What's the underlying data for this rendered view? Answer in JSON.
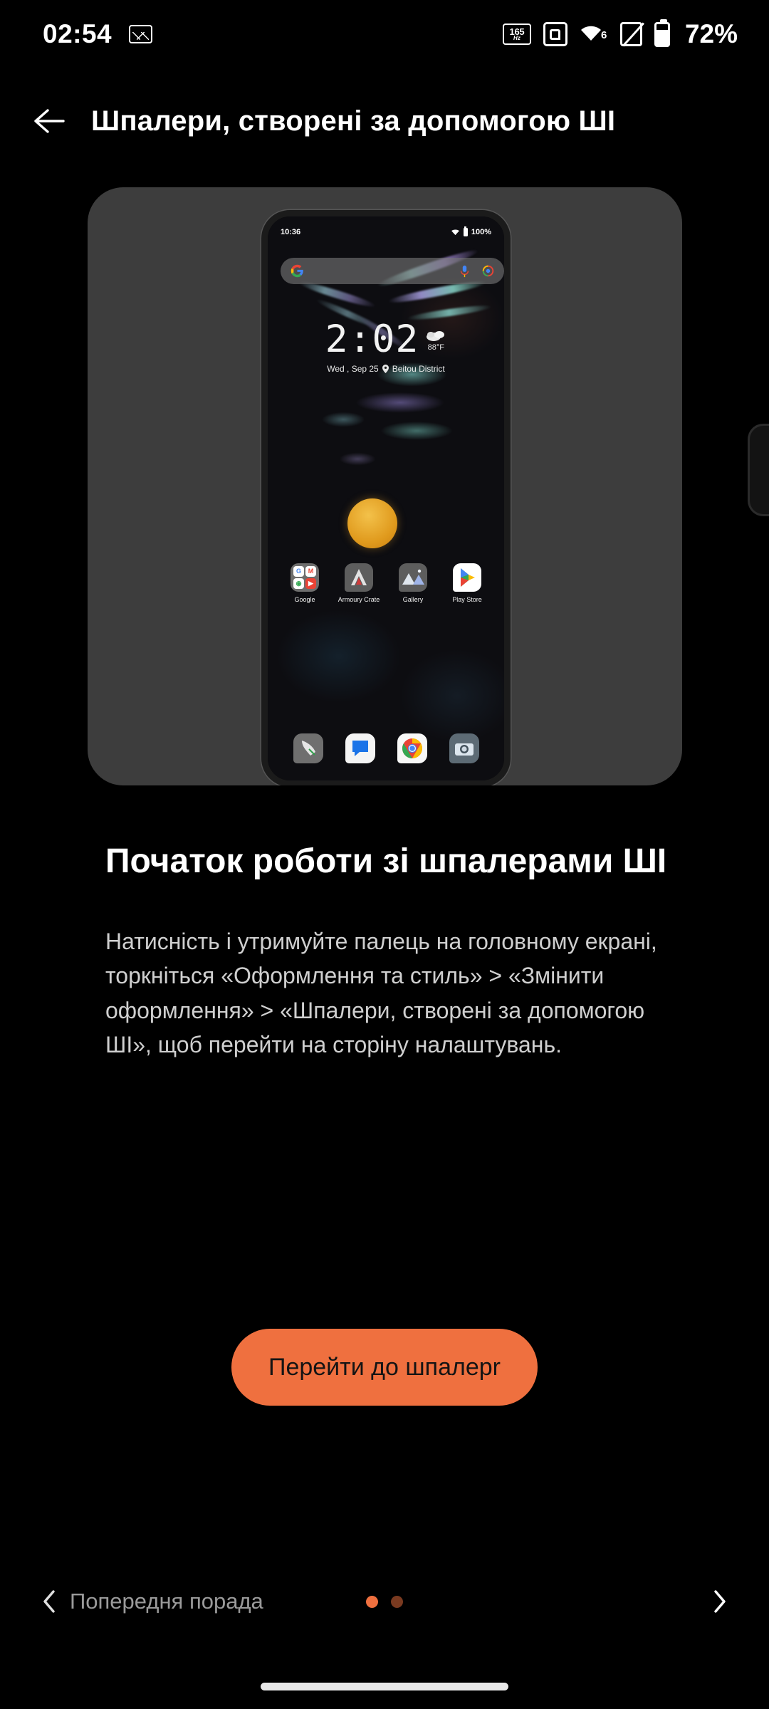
{
  "status_bar": {
    "time": "02:54",
    "battery_percent": "72%",
    "icons": [
      {
        "name": "screenshot-icon",
        "label": ""
      },
      {
        "name": "refresh-rate-icon",
        "label": "165",
        "unit": "Hz"
      },
      {
        "name": "screen-recorder-icon",
        "label": ""
      },
      {
        "name": "wifi-6-icon",
        "label": "6"
      },
      {
        "name": "no-sim-icon",
        "label": ""
      },
      {
        "name": "battery-icon",
        "label": ""
      }
    ]
  },
  "app_bar": {
    "back_icon": "arrow-left-icon",
    "title": "Шпалери, створені за допомогою ШІ"
  },
  "hero": {
    "phone_preview": {
      "status_time": "10:36",
      "status_battery": "100%",
      "search_placeholder": "",
      "search_logo": "google-g-icon",
      "mic_icon": "microphone-icon",
      "lens_icon": "google-lens-icon",
      "clock": "2:02",
      "temperature": "88°F",
      "weather_icon": "cloudy-icon",
      "date": "Wed , Sep 25",
      "location": "Beitou District",
      "location_icon": "location-pin-icon",
      "apps": [
        {
          "label": "Google",
          "icon": "google-folder-icon"
        },
        {
          "label": "Armoury Crate",
          "icon": "armoury-crate-icon"
        },
        {
          "label": "Gallery",
          "icon": "gallery-icon"
        },
        {
          "label": "Play Store",
          "icon": "play-store-icon"
        }
      ],
      "dock": [
        {
          "icon": "phone-dialer-icon"
        },
        {
          "icon": "messages-icon"
        },
        {
          "icon": "chrome-icon"
        },
        {
          "icon": "camera-icon"
        }
      ]
    }
  },
  "content": {
    "heading": "Початок роботи зі шпалерами ШІ",
    "paragraph": "Натисність і утримуйте палець на головному екрані, торкніться «Оформлення та стиль» > «Змінити оформлення» > «Шпалери, створені за допомогою ШІ», щоб перейти на сторіну налаштувань."
  },
  "cta": {
    "label": "Перейти до шпалерr"
  },
  "bottom_nav": {
    "prev_label": "Попередня порада",
    "prev_icon": "chevron-left-icon",
    "next_icon": "chevron-right-icon",
    "page_count": 2,
    "active_page": 1
  },
  "colors": {
    "background": "#000000",
    "card": "#3d3d3d",
    "accent": "#ef703f",
    "accent_dim": "#7a3a20",
    "text_primary": "#ffffff",
    "text_secondary": "#cfcfcf",
    "text_muted": "#9a9a9a"
  }
}
